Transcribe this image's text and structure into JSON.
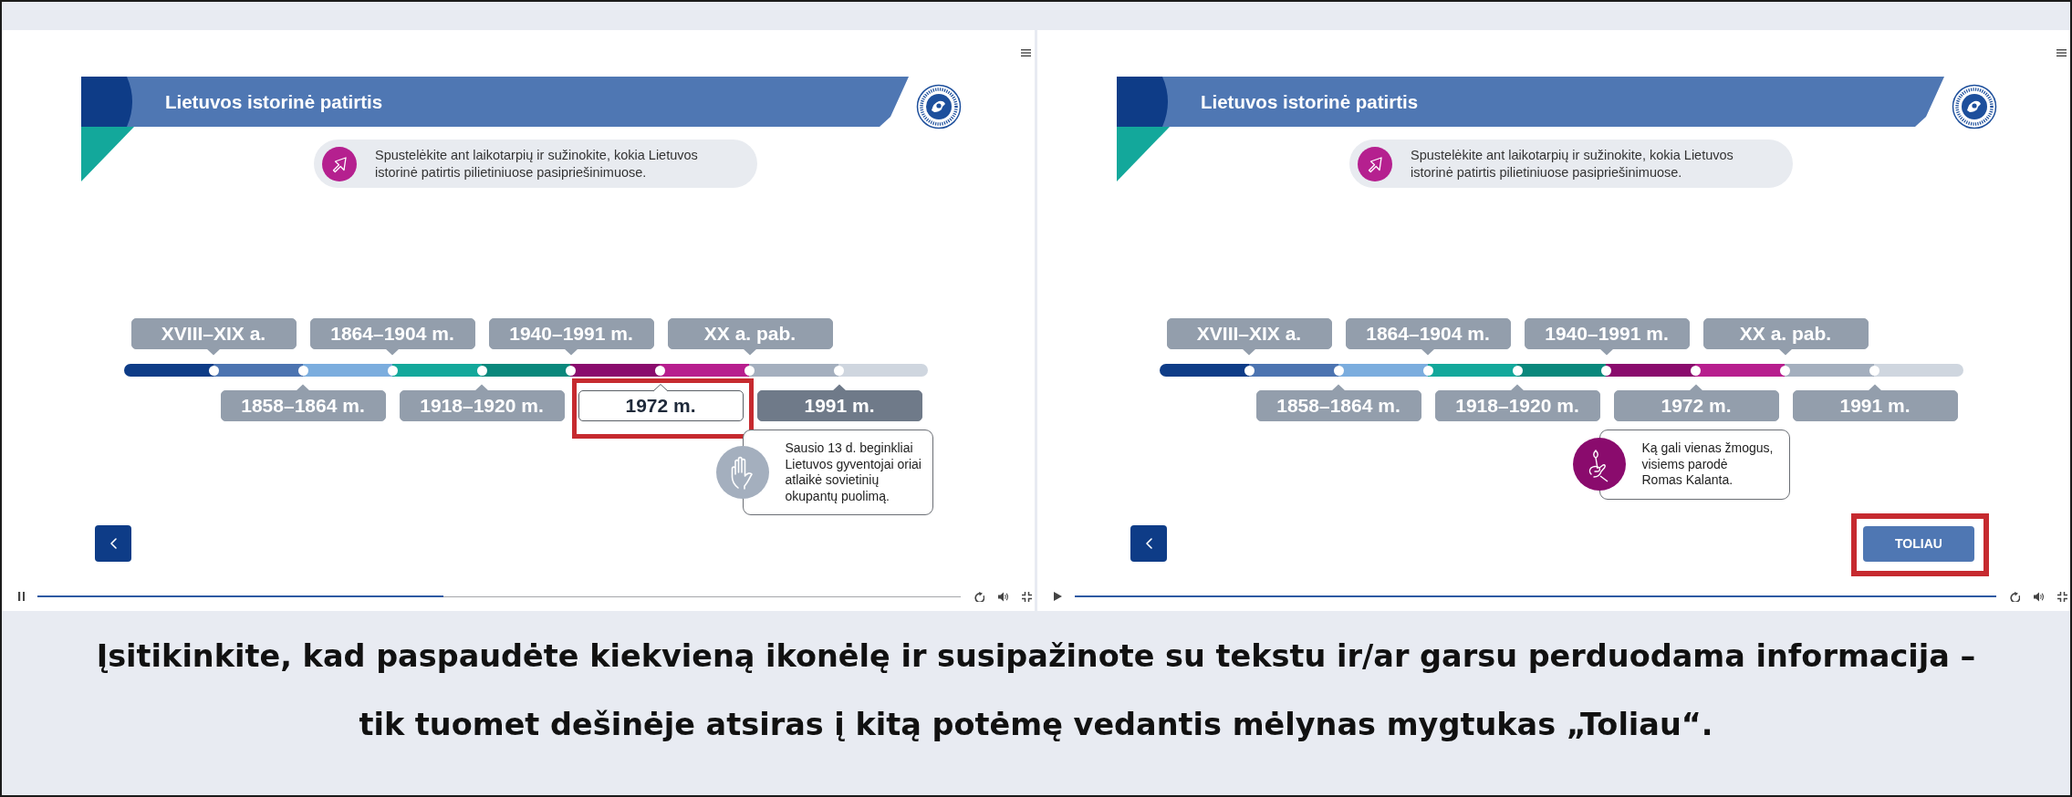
{
  "panels": [
    {
      "title": "Lietuvos istorinė patirtis",
      "instruction": "Spustelėkite ant laikotarpių ir sužinokite, kokia Lietuvos istorinė patirtis pilietiniuose pasipriešinimuose.",
      "timeline": [
        {
          "label": "XVIII–XIX a.",
          "color": "#0e3c87",
          "selected": false,
          "hovered": false
        },
        {
          "label": "1858–1864 m.",
          "color": "#4c74b1",
          "selected": false,
          "hovered": false
        },
        {
          "label": "1864–1904 m.",
          "color": "#7badde",
          "selected": false,
          "hovered": false
        },
        {
          "label": "1918–1920 m.",
          "color": "#13a89b",
          "selected": false,
          "hovered": false
        },
        {
          "label": "1940–1991 m.",
          "color": "#0a887c",
          "selected": false,
          "hovered": false
        },
        {
          "label": "1972 m.",
          "color": "#8a0b6d",
          "selected": false,
          "hovered": true,
          "annotated": true
        },
        {
          "label": "XX a. pab.",
          "color": "#b71e8e",
          "selected": false,
          "hovered": false
        },
        {
          "label": "1991 m.",
          "color": "#a4afbe",
          "selected": true,
          "hovered": false,
          "callout": {
            "kind": "hand",
            "text": "Sausio 13 d. beginkliai\nLietuvos gyventojai oriai\natlaikė sovietinių\nokupantų puolimą."
          }
        }
      ],
      "player": {
        "playing": true,
        "level": 0.44
      }
    },
    {
      "title": "Lietuvos istorinė patirtis",
      "instruction": "Spustelėkite ant laikotarpių ir sužinokite, kokia Lietuvos istorinė patirtis pilietiniuose pasipriešinimuose.",
      "timeline": [
        {
          "label": "XVIII–XIX a.",
          "color": "#0e3c87",
          "selected": false,
          "hovered": false
        },
        {
          "label": "1858–1864 m.",
          "color": "#4c74b1",
          "selected": false,
          "hovered": false
        },
        {
          "label": "1864–1904 m.",
          "color": "#7badde",
          "selected": false,
          "hovered": false
        },
        {
          "label": "1918–1920 m.",
          "color": "#13a89b",
          "selected": false,
          "hovered": false
        },
        {
          "label": "1940–1991 m.",
          "color": "#0a887c",
          "selected": false,
          "hovered": false
        },
        {
          "label": "1972 m.",
          "color": "#8a0b6d",
          "selected": false,
          "hovered": false,
          "callout": {
            "kind": "match",
            "text": "Ką gali vienas žmogus,\nvisiems parodė\nRomas Kalanta."
          }
        },
        {
          "label": "XX a. pab.",
          "color": "#b71e8e",
          "selected": false,
          "hovered": false
        },
        {
          "label": "1991 m.",
          "color": "#a4afbe",
          "selected": false,
          "hovered": false
        }
      ],
      "next_button": {
        "label": "TOLIAU",
        "annotated": true
      },
      "player": {
        "playing": false,
        "level": 1
      }
    }
  ],
  "caption": "Įsitikinkite, kad paspaudėte kiekvieną ikonėlę ir susipažinote su tekstu ir/ar garsu perduodama informacija –\ntik tuomet dešinėje atsiras į kitą potėmę vedantis mėlynas mygtukas „Toliau“."
}
